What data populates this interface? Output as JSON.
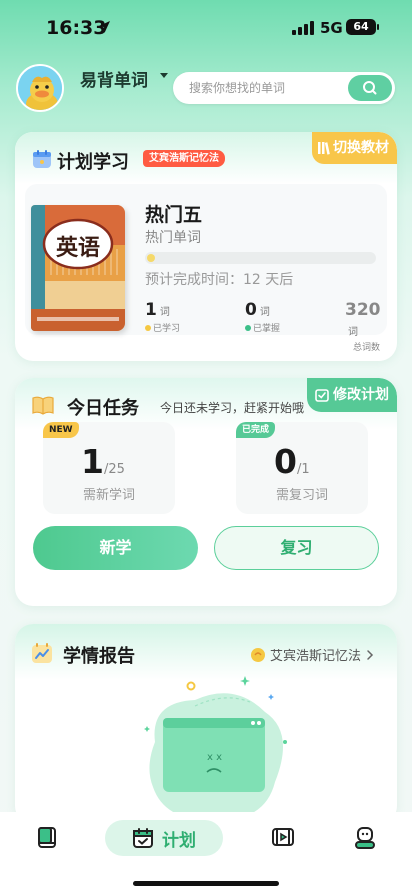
{
  "status_bar": {
    "time": "16:33",
    "network": "5G",
    "battery": "64"
  },
  "header": {
    "app_title": "易背单词",
    "search_placeholder": "搜索你想找的单词",
    "icons": [
      "avatar-duck",
      "chevron-down-icon",
      "search-icon"
    ]
  },
  "plan": {
    "title": "计划学习",
    "method_tag": "艾宾浩斯记忆法",
    "switch_label": "切换教材",
    "book": {
      "cover_text": "英语",
      "name": "热门五",
      "subtitle": "热门单词",
      "progress": 0,
      "eta": "预计完成时间：12 天后"
    },
    "stats": [
      {
        "value": "1",
        "unit": "词",
        "label": "已学习",
        "color": "#f5c842"
      },
      {
        "value": "0",
        "unit": "词",
        "label": "已掌握",
        "color": "#3bbf88"
      },
      {
        "value": "320",
        "unit": "词",
        "label": "总词数",
        "color": ""
      }
    ]
  },
  "task": {
    "title": "今日任务",
    "hint": "今日还未学习，赶紧开始哦",
    "modify_label": "修改计划",
    "boxes": [
      {
        "tag": "NEW",
        "num": "1",
        "den": "/25",
        "label": "需新学词"
      },
      {
        "tag": "已完成",
        "num": "0",
        "den": "/1",
        "label": "需复习词"
      }
    ],
    "btn_new": "新学",
    "btn_review": "复习"
  },
  "report": {
    "title": "学情报告",
    "link_label": "艾宾浩斯记忆法"
  },
  "tabbar": {
    "active_label": "计划",
    "items": [
      "book-icon",
      "calendar-icon",
      "video-icon",
      "profile-icon"
    ]
  },
  "colors": {
    "primary": "#4ec98f",
    "accent_yellow": "#f8c64a",
    "tag_red": "#ff5b42"
  }
}
